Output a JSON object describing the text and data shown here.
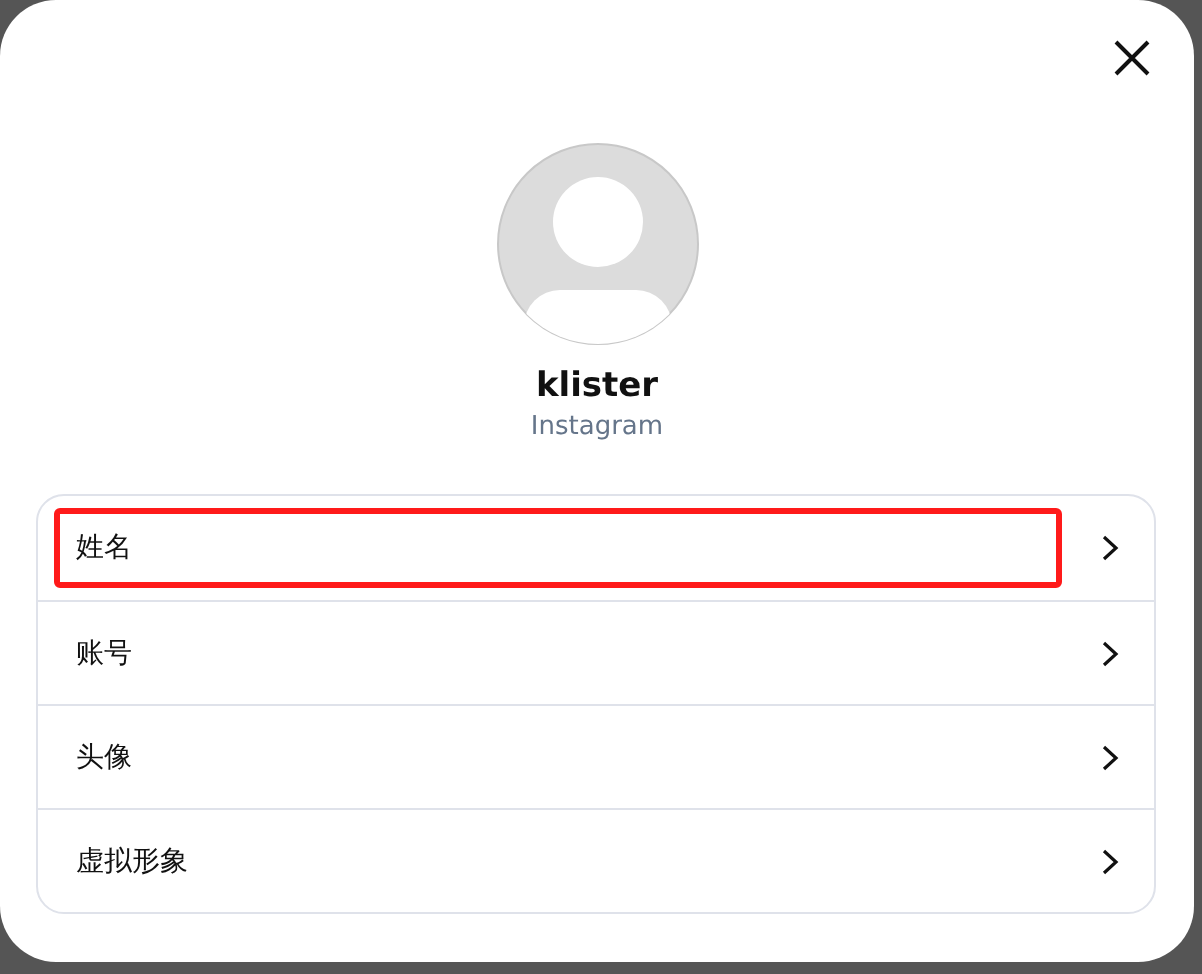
{
  "profile": {
    "name": "klister",
    "platform": "Instagram"
  },
  "items": [
    {
      "label": "姓名",
      "highlighted": true
    },
    {
      "label": "账号",
      "highlighted": false
    },
    {
      "label": "头像",
      "highlighted": false
    },
    {
      "label": "虚拟形象",
      "highlighted": false
    }
  ]
}
